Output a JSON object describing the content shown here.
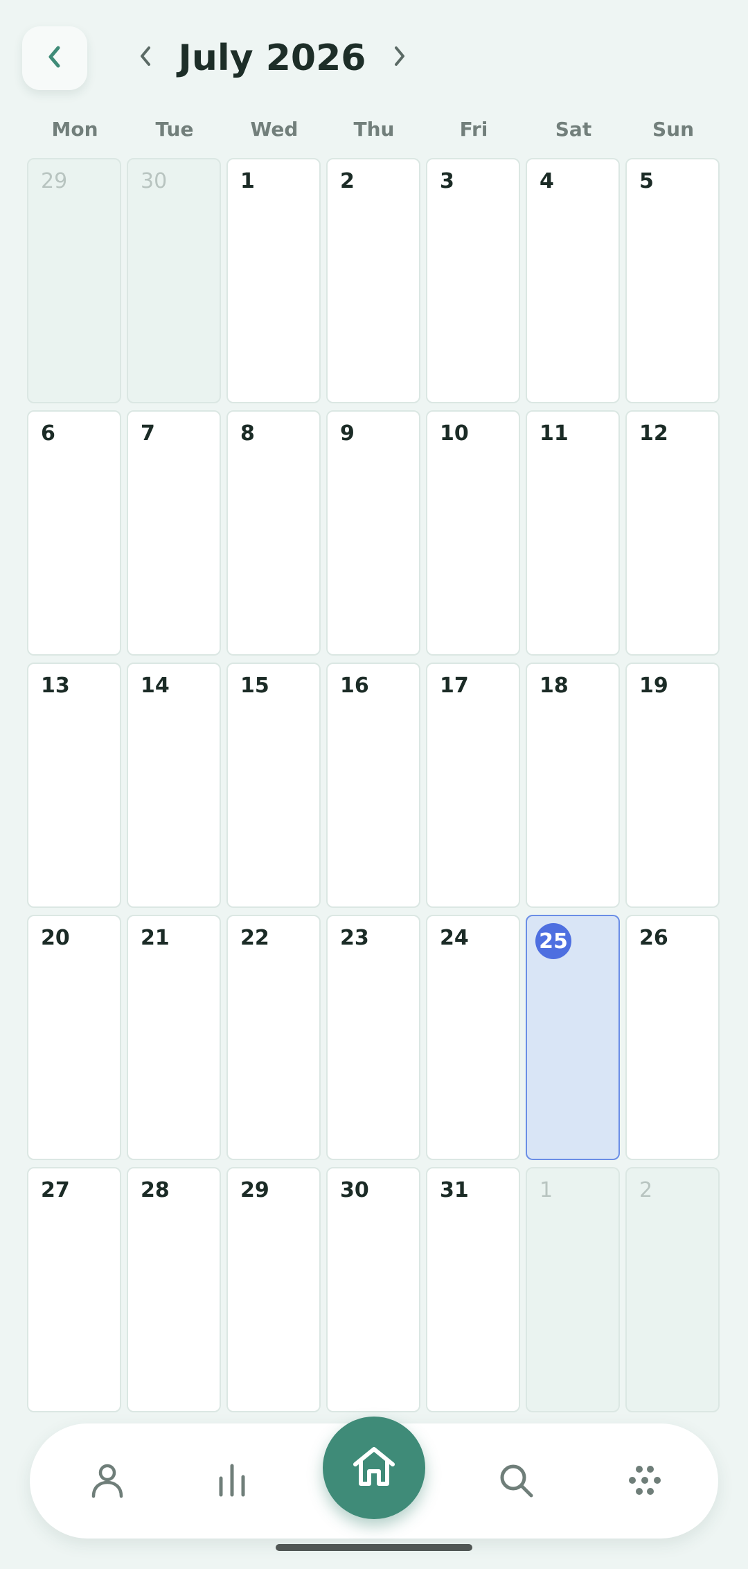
{
  "header": {
    "month_title": "July 2026",
    "back_icon": "chevron-left-icon",
    "prev_icon": "chevron-left-icon",
    "next_icon": "chevron-right-icon"
  },
  "weekdays": [
    "Mon",
    "Tue",
    "Wed",
    "Thu",
    "Fri",
    "Sat",
    "Sun"
  ],
  "weeks": [
    [
      {
        "d": "29",
        "other": true
      },
      {
        "d": "30",
        "other": true
      },
      {
        "d": "1"
      },
      {
        "d": "2"
      },
      {
        "d": "3"
      },
      {
        "d": "4"
      },
      {
        "d": "5"
      }
    ],
    [
      {
        "d": "6"
      },
      {
        "d": "7"
      },
      {
        "d": "8"
      },
      {
        "d": "9"
      },
      {
        "d": "10"
      },
      {
        "d": "11"
      },
      {
        "d": "12"
      }
    ],
    [
      {
        "d": "13"
      },
      {
        "d": "14"
      },
      {
        "d": "15"
      },
      {
        "d": "16"
      },
      {
        "d": "17"
      },
      {
        "d": "18"
      },
      {
        "d": "19"
      }
    ],
    [
      {
        "d": "20"
      },
      {
        "d": "21"
      },
      {
        "d": "22"
      },
      {
        "d": "23"
      },
      {
        "d": "24"
      },
      {
        "d": "25",
        "today": true
      },
      {
        "d": "26"
      }
    ],
    [
      {
        "d": "27"
      },
      {
        "d": "28"
      },
      {
        "d": "29"
      },
      {
        "d": "30"
      },
      {
        "d": "31"
      },
      {
        "d": "1",
        "other": true
      },
      {
        "d": "2",
        "other": true
      }
    ]
  ],
  "bottom_nav": {
    "items": [
      "profile-icon",
      "stats-icon",
      "home-icon",
      "search-icon",
      "apps-icon"
    ]
  },
  "colors": {
    "accent": "#3f8b78",
    "today": "#4e6fe0",
    "today_bg": "#d9e5f6",
    "background": "#eef5f3"
  }
}
